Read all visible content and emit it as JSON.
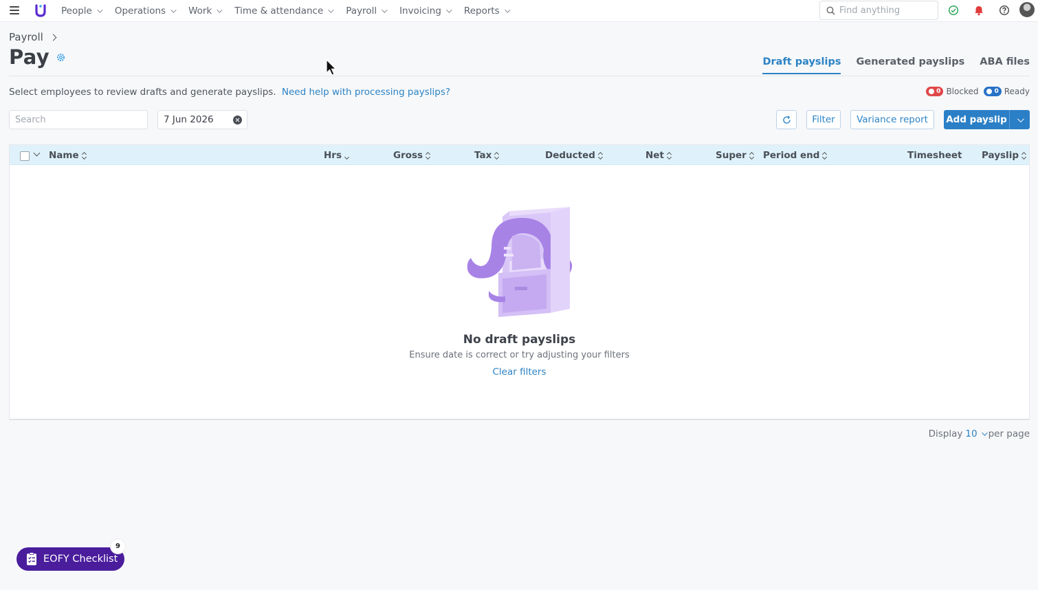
{
  "nav": {
    "items": [
      {
        "label": "People"
      },
      {
        "label": "Operations"
      },
      {
        "label": "Work"
      },
      {
        "label": "Time & attendance"
      },
      {
        "label": "Payroll"
      },
      {
        "label": "Invoicing"
      },
      {
        "label": "Reports"
      }
    ],
    "search_placeholder": "Find anything"
  },
  "breadcrumb": {
    "parent": "Payroll"
  },
  "page": {
    "title": "Pay"
  },
  "tabs": [
    {
      "label": "Draft payslips",
      "active": true
    },
    {
      "label": "Generated payslips",
      "active": false
    },
    {
      "label": "ABA files",
      "active": false
    }
  ],
  "intro": {
    "text": "Select employees to review drafts and generate payslips.",
    "help_link": "Need help with processing payslips?"
  },
  "legend": {
    "blocked": {
      "count": "0",
      "label": "Blocked"
    },
    "ready": {
      "count": "0",
      "label": "Ready"
    }
  },
  "controls": {
    "search_placeholder": "Search",
    "date": "7 Jun 2026",
    "filter_label": "Filter",
    "variance_label": "Variance report",
    "add_label": "Add payslip"
  },
  "table": {
    "columns": [
      "Name",
      "Hrs",
      "Gross",
      "Tax",
      "Deducted",
      "Net",
      "Super",
      "Period end",
      "Timesheet",
      "Payslip"
    ]
  },
  "empty": {
    "title": "No draft payslips",
    "subtitle": "Ensure date is correct or try adjusting your filters",
    "link": "Clear filters"
  },
  "pagination": {
    "prefix": "Display",
    "value": "10",
    "suffix": "per page"
  },
  "eofy": {
    "label": "EOFY Checklist",
    "badge": "9"
  },
  "colors": {
    "accent": "#2b83c5",
    "primary_button": "#2b7fc6",
    "eofy": "#4a1d9c",
    "blocked": "#e0474a",
    "ready": "#2872c7",
    "table_header": "#dff2fb"
  }
}
